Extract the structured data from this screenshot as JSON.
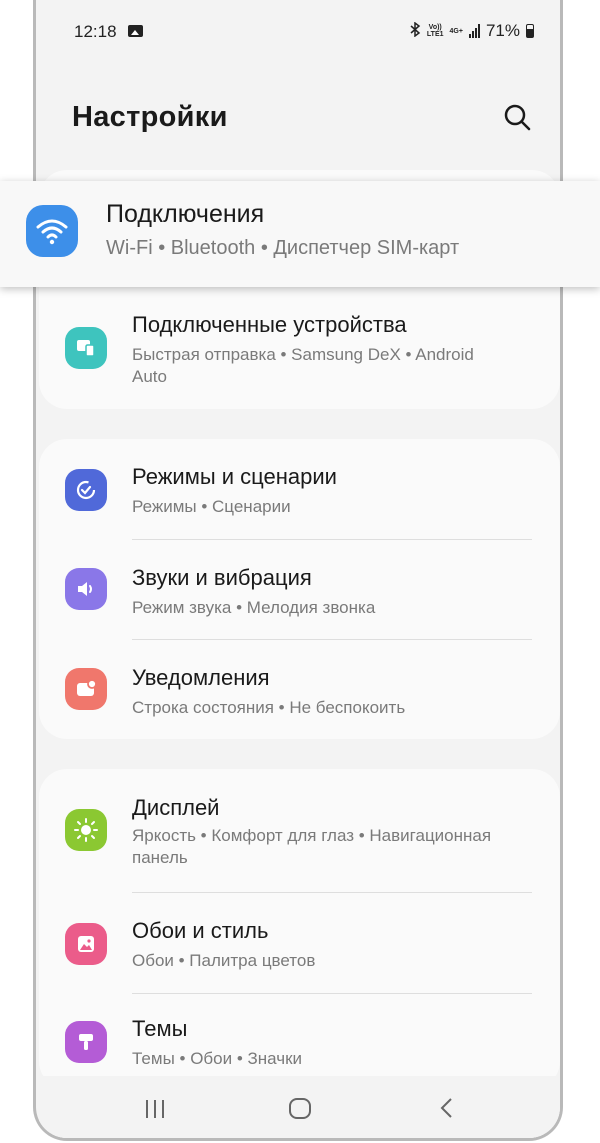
{
  "status_bar": {
    "time": "12:18",
    "network": "4G+",
    "volte_line1": "Vo))",
    "volte_line2": "LTE1",
    "battery_percent": "71%",
    "icons": [
      "image-icon",
      "bluetooth-icon",
      "volte-icon",
      "signal-icon",
      "battery-icon"
    ]
  },
  "header": {
    "title": "Настройки",
    "search_icon": "search-icon"
  },
  "highlighted_item": {
    "title": "Подключения",
    "subtitle": "Wi-Fi • Bluetooth • Диспетчер SIM-карт",
    "icon": "wifi-icon",
    "color": "#3d8fe9"
  },
  "cards": [
    {
      "items": [
        {
          "title": "Подключенные устройства",
          "subtitle": "Быстрая отправка • Samsung DeX • Android Auto",
          "icon": "devices-icon",
          "color": "#3ec4be"
        }
      ]
    },
    {
      "items": [
        {
          "title": "Режимы и сценарии",
          "subtitle": "Режимы • Сценарии",
          "icon": "modes-icon",
          "color": "#5069d9"
        },
        {
          "title": "Звуки и вибрация",
          "subtitle": "Режим звука • Мелодия звонка",
          "icon": "sound-icon",
          "color": "#8a77e8"
        },
        {
          "title": "Уведомления",
          "subtitle": "Строка состояния • Не беспокоить",
          "icon": "notification-icon",
          "color": "#f0776c"
        }
      ]
    },
    {
      "items": [
        {
          "title": "Дисплей",
          "subtitle": "Яркость • Комфорт для глаз • Навигационная панель",
          "icon": "display-icon",
          "color": "#8bc832"
        },
        {
          "title": "Обои и стиль",
          "subtitle": "Обои • Палитра цветов",
          "icon": "wallpaper-icon",
          "color": "#eb5c8a"
        },
        {
          "title": "Темы",
          "subtitle": "Темы • Обои • Значки",
          "icon": "themes-icon",
          "color": "#b45cd6"
        }
      ]
    }
  ],
  "navbar": {
    "icons": [
      "recent-apps-icon",
      "home-icon",
      "back-icon"
    ]
  }
}
